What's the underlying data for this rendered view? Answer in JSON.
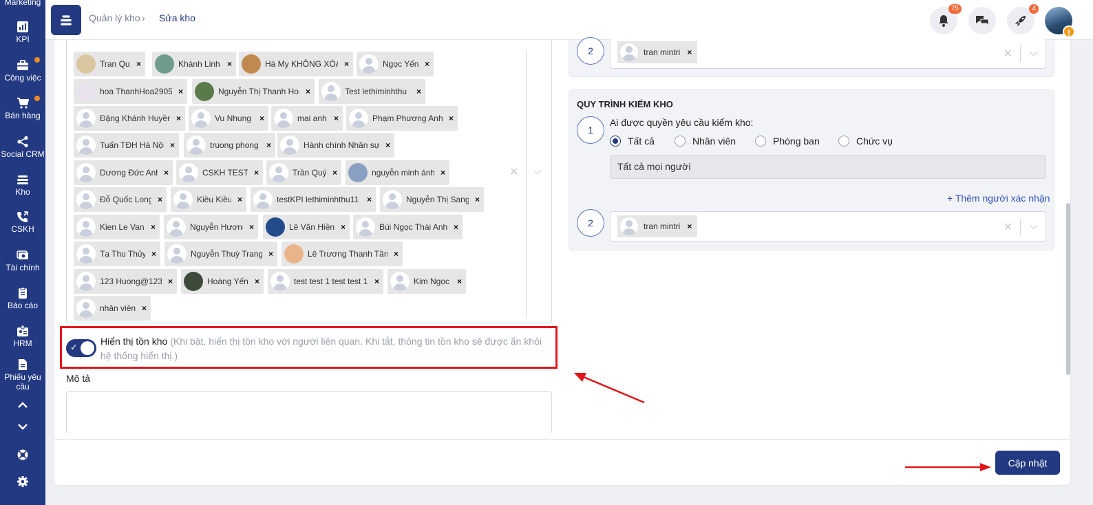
{
  "sidebar": {
    "items": [
      {
        "label": "Marketing",
        "icon": "marketing-icon"
      },
      {
        "label": "KPI",
        "icon": "chart-icon"
      },
      {
        "label": "Công việc",
        "icon": "briefcase-icon"
      },
      {
        "label": "Bán hàng",
        "icon": "cart-icon"
      },
      {
        "label": "Social CRM",
        "icon": "share-icon"
      },
      {
        "label": "Kho",
        "icon": "warehouse-icon"
      },
      {
        "label": "CSKH",
        "icon": "phone-icon"
      },
      {
        "label": "Tài chính",
        "icon": "money-icon"
      },
      {
        "label": "Báo cáo",
        "icon": "clipboard-icon"
      },
      {
        "label": "HRM",
        "icon": "id-card-icon"
      },
      {
        "label": "Phiếu yêu cầu",
        "icon": "document-icon"
      }
    ],
    "dot_color": "#f08a24",
    "bg_color": "#233a82"
  },
  "header": {
    "breadcrumb_parent": "Quản lý kho",
    "breadcrumb_sep": "›",
    "breadcrumb_current": "Sửa kho",
    "notifications_badge": "75",
    "rocket_badge": "4",
    "avatar_warning": "!"
  },
  "tags": [
    {
      "name": "Tran Quy",
      "avatar": "photo"
    },
    {
      "name": "Khánh Linh",
      "avatar": "photo"
    },
    {
      "name": "Hà My KHÔNG XÓA",
      "avatar": "photo"
    },
    {
      "name": "Ngọc Yến",
      "avatar": "blank"
    },
    {
      "name": "hoa ThanhHoa2905",
      "avatar": "photo"
    },
    {
      "name": "Nguyễn Thị Thanh Hoa",
      "avatar": "photo"
    },
    {
      "name": "Test lethiminhthu",
      "avatar": "blank"
    },
    {
      "name": "Đặng Khánh Huyền",
      "avatar": "blank"
    },
    {
      "name": "Vu Nhung",
      "avatar": "blank"
    },
    {
      "name": "mai anh",
      "avatar": "blank"
    },
    {
      "name": "Phạm Phương Anh",
      "avatar": "blank"
    },
    {
      "name": "Tuấn TĐH Hà Nội",
      "avatar": "blank"
    },
    {
      "name": "truong phong",
      "avatar": "blank"
    },
    {
      "name": "Hành chính Nhân sự",
      "avatar": "blank"
    },
    {
      "name": "Dương Đức Anh",
      "avatar": "blank"
    },
    {
      "name": "CSKH TEST",
      "avatar": "blank"
    },
    {
      "name": "Trần Quý",
      "avatar": "blank"
    },
    {
      "name": "nguyễn minh ánh",
      "avatar": "photo"
    },
    {
      "name": "Đỗ Quốc Long",
      "avatar": "blank"
    },
    {
      "name": "Kiều Kiều",
      "avatar": "blank"
    },
    {
      "name": "testKPI lethiminhthu11",
      "avatar": "blank"
    },
    {
      "name": "Nguyễn Thị Sang",
      "avatar": "blank"
    },
    {
      "name": "Kien Le Van",
      "avatar": "blank"
    },
    {
      "name": "Nguyễn Hương",
      "avatar": "blank"
    },
    {
      "name": "Lê Văn Hiền",
      "avatar": "photo"
    },
    {
      "name": "Bùi Ngọc Thái Anh",
      "avatar": "blank"
    },
    {
      "name": "Tạ Thu Thủy",
      "avatar": "blank"
    },
    {
      "name": "Nguyễn Thuỳ Trang",
      "avatar": "blank"
    },
    {
      "name": "Lê Trương Thanh Tâm",
      "avatar": "photo"
    },
    {
      "name": "123 Huong@123",
      "avatar": "blank"
    },
    {
      "name": "Hoàng Yến",
      "avatar": "photo"
    },
    {
      "name": "test test 1 test test 1",
      "avatar": "blank"
    },
    {
      "name": "Kim Ngọc",
      "avatar": "blank"
    },
    {
      "name": "nhân viên",
      "avatar": "blank"
    }
  ],
  "tag_remove": "×",
  "toggle": {
    "title": "Hiển thị tồn kho",
    "hint": "(Khi bật, hiển thị tồn kho với người liên quan. Khi tắt, thông tin tồn kho sẽ được ẩn khỏi hệ thống hiển thị.)",
    "on": true
  },
  "description": {
    "label": "Mô tả",
    "value": ""
  },
  "top_step": {
    "number": "2",
    "chip": "tran mintri"
  },
  "check_process": {
    "title": "QUY TRÌNH KIỂM KHO",
    "step1_number": "1",
    "question": "Ai được quyền yêu cầu kiểm kho:",
    "options": [
      "Tất cả",
      "Nhân viên",
      "Phòng ban",
      "Chức vụ"
    ],
    "selected": "Tất cả",
    "all_value": "Tất cả mọi người",
    "add_confirmer": "+ Thêm người xác nhận",
    "step2_number": "2",
    "step2_chip": "tran mintri"
  },
  "footer": {
    "update_label": "Cập nhật"
  },
  "colors": {
    "primary": "#233a82",
    "highlight": "#e0161b",
    "badge": "#f26b3a",
    "link": "#2f55b8"
  }
}
